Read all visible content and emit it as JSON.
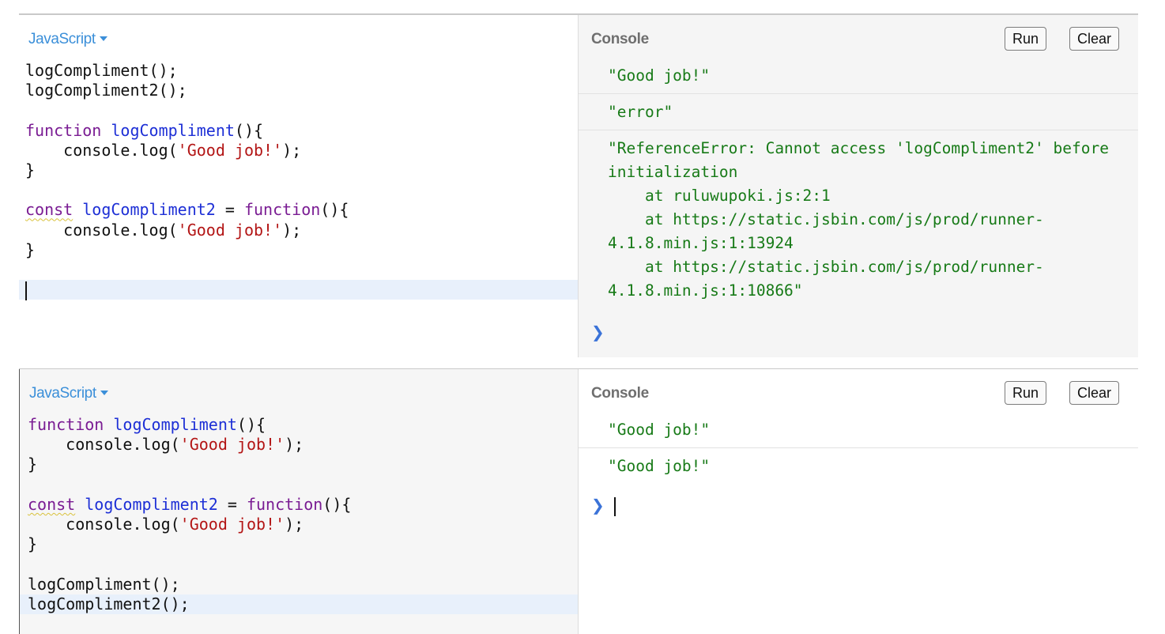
{
  "panels": [
    {
      "editor": {
        "language_label": "JavaScript",
        "lines": [
          "logCompliment();",
          "logCompliment2();",
          "",
          "function logCompliment(){",
          "    console.log('Good job!');",
          "}",
          "",
          "const logCompliment2 = function(){",
          "    console.log('Good job!');",
          "}",
          "",
          ""
        ]
      },
      "console": {
        "title": "Console",
        "run_label": "Run",
        "clear_label": "Clear",
        "logs": [
          "\"Good job!\"",
          "\"error\"",
          "\"ReferenceError: Cannot access 'logCompliment2' before initialization\n    at ruluwupoki.js:2:1\n    at https://static.jsbin.com/js/prod/runner-4.1.8.min.js:1:13924\n    at https://static.jsbin.com/js/prod/runner-4.1.8.min.js:1:10866\""
        ],
        "prompt_symbol": "❯"
      }
    },
    {
      "editor": {
        "language_label": "JavaScript",
        "lines": [
          "function logCompliment(){",
          "    console.log('Good job!');",
          "}",
          "",
          "const logCompliment2 = function(){",
          "    console.log('Good job!');",
          "}",
          "",
          "logCompliment();",
          "logCompliment2();"
        ]
      },
      "console": {
        "title": "Console",
        "run_label": "Run",
        "clear_label": "Clear",
        "logs": [
          "\"Good job!\"",
          "\"Good job!\""
        ],
        "prompt_symbol": "❯"
      }
    }
  ],
  "colors": {
    "keyword": "#7a1c93",
    "function_name": "#1d2fd6",
    "string": "#b31515",
    "console_output": "#177a17",
    "link_blue": "#3b8fd9"
  }
}
